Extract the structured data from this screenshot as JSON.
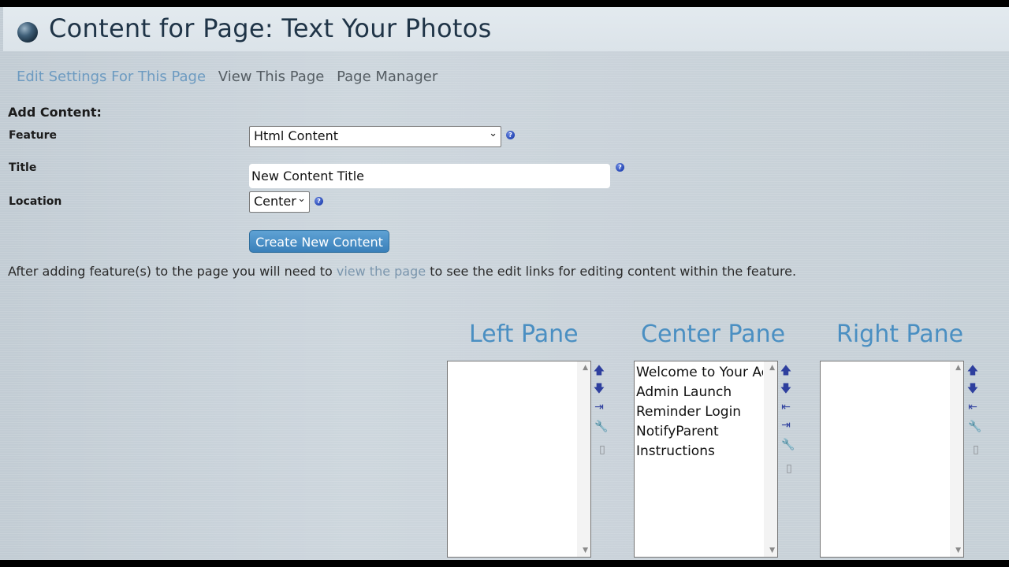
{
  "header": {
    "title": "Content for Page: Text Your Photos"
  },
  "nav": {
    "edit_settings": "Edit Settings For This Page",
    "view_page": "View This Page",
    "page_manager": "Page Manager"
  },
  "form": {
    "section_label": "Add Content:",
    "feature_label": "Feature",
    "feature_value": "Html Content",
    "title_label": "Title",
    "title_value": "New Content Title",
    "location_label": "Location",
    "location_value": "Center",
    "create_button": "Create New Content",
    "help_glyph": "?"
  },
  "info": {
    "before": "After adding feature(s) to the page you will need to ",
    "link": "view the page",
    "after": " to see the edit links for editing content within the feature."
  },
  "panes": {
    "left": {
      "heading": "Left Pane",
      "items": []
    },
    "center": {
      "heading": "Center Pane",
      "items": [
        "Welcome to Your Acc",
        "Admin Launch",
        "Reminder Login",
        "NotifyParent",
        "Instructions"
      ]
    },
    "right": {
      "heading": "Right Pane",
      "items": []
    }
  },
  "icons": {
    "move_up": "arrow-up-icon",
    "move_down": "arrow-down-icon",
    "move_right": "move-to-right-pane-icon",
    "move_left": "move-to-left-pane-icon",
    "edit": "wrench-icon",
    "delete": "trash-icon"
  },
  "colors": {
    "heading_blue": "#4a8fc2",
    "button_blue": "#3a80ba",
    "link_blue": "#6d9bc1"
  }
}
